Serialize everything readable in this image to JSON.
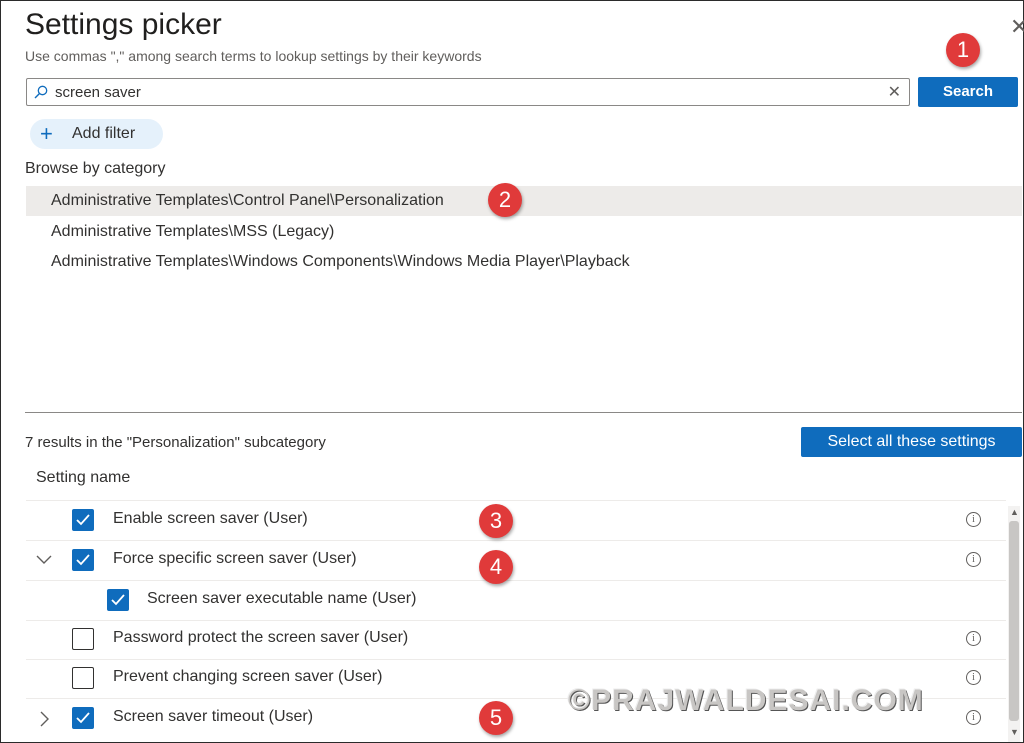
{
  "panel": {
    "title": "Settings picker",
    "subtitle": "Use commas \",\" among search terms to lookup settings by their keywords",
    "close_label": "✕"
  },
  "search": {
    "value": "screen saver",
    "clear_label": "✕",
    "button_label": "Search"
  },
  "filter": {
    "add_label": "Add filter",
    "plus": "+"
  },
  "browse": {
    "title": "Browse by category",
    "categories": [
      "Administrative Templates\\Control Panel\\Personalization",
      "Administrative Templates\\MSS (Legacy)",
      "Administrative Templates\\Windows Components\\Windows Media Player\\Playback"
    ],
    "selected_index": 0
  },
  "results": {
    "summary": "7 results in the \"Personalization\" subcategory",
    "select_all_label": "Select all these settings",
    "column_header": "Setting name",
    "rows": [
      {
        "label": "Enable screen saver (User)",
        "checked": true,
        "expander": "",
        "indent": 0,
        "info": true
      },
      {
        "label": "Force specific screen saver (User)",
        "checked": true,
        "expander": "expanded",
        "indent": 0,
        "info": true
      },
      {
        "label": "Screen saver executable name (User)",
        "checked": true,
        "expander": "",
        "indent": 1,
        "info": false
      },
      {
        "label": "Password protect the screen saver (User)",
        "checked": false,
        "expander": "",
        "indent": 0,
        "info": true
      },
      {
        "label": "Prevent changing screen saver (User)",
        "checked": false,
        "expander": "",
        "indent": 0,
        "info": true
      },
      {
        "label": "Screen saver timeout (User)",
        "checked": true,
        "expander": "collapsed",
        "indent": 0,
        "info": true
      }
    ]
  },
  "annotations": [
    "1",
    "2",
    "3",
    "4",
    "5"
  ],
  "watermark": "©PRAJWALDESAI.COM",
  "colors": {
    "accent": "#0f6cbd",
    "badge": "#e03a3a",
    "selected_row": "#edebe9"
  },
  "icons": {
    "search": "search-icon",
    "info": "info-icon",
    "checkmark": "checkmark-icon",
    "chevron_down": "chevron-down-icon",
    "chevron_right": "chevron-right-icon"
  }
}
